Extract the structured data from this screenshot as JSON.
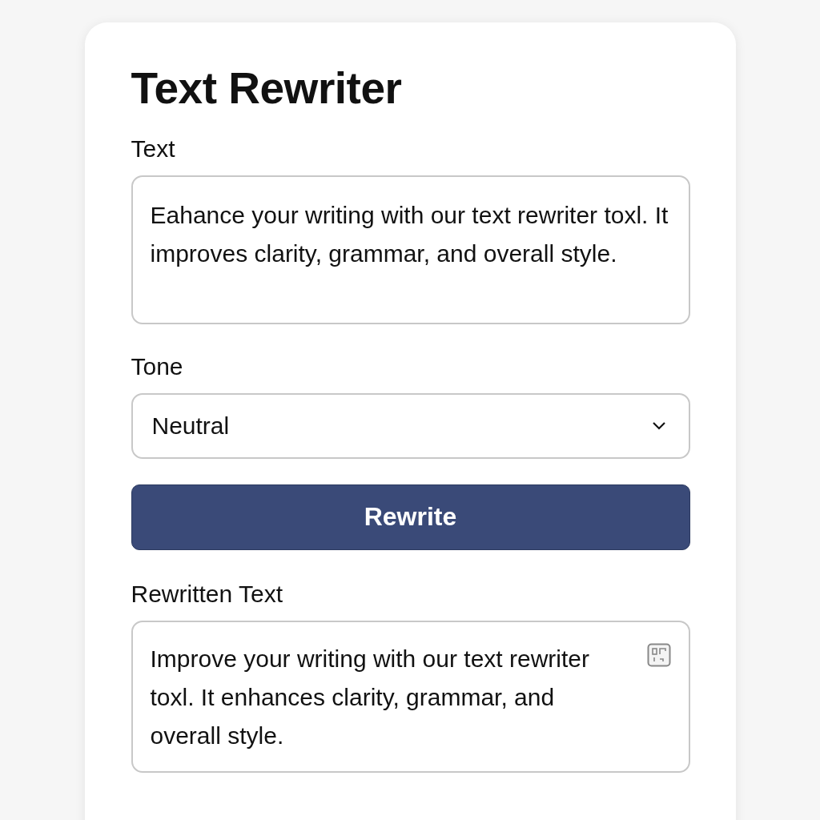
{
  "title": "Text Rewriter",
  "text_field": {
    "label": "Text",
    "value": "Eahance your writing with our text rewriter toxl. It improves clarity, grammar, and overall style."
  },
  "tone_field": {
    "label": "Tone",
    "value": "Neutral"
  },
  "rewrite_button": {
    "label": "Rewrite"
  },
  "output_field": {
    "label": "Rewritten Text",
    "value": "Improve your writing with our text rewriter toxl. It enhances clarity, grammar, and overall style."
  }
}
